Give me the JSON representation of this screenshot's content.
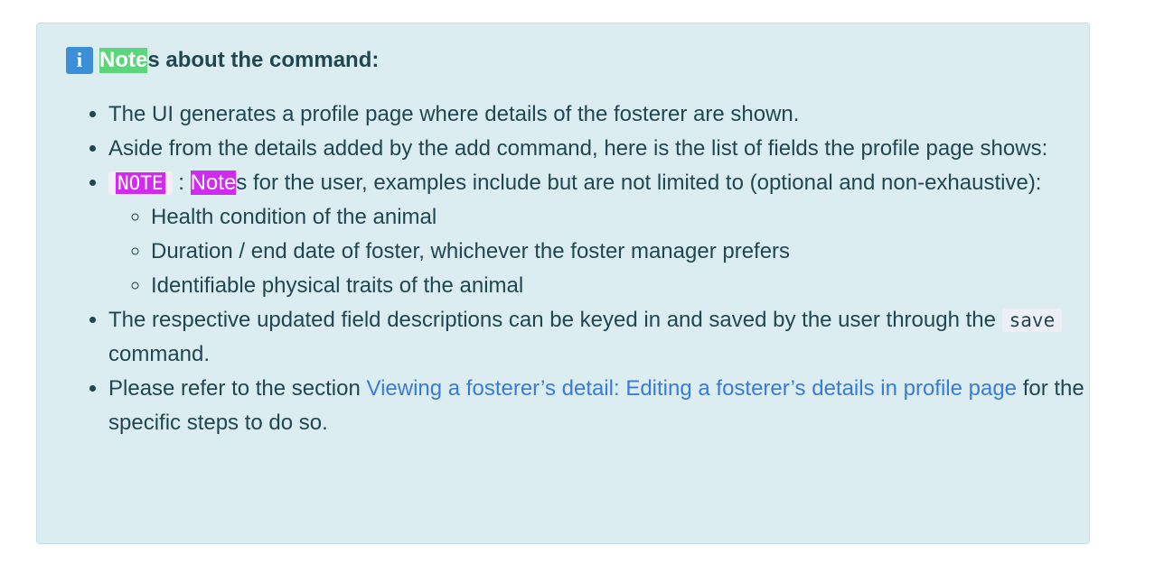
{
  "header": {
    "icon": "info-icon",
    "icon_glyph": "i",
    "title_highlight": "Note",
    "title_rest": "s about the command:"
  },
  "items": {
    "item1": "The UI generates a profile page where details of the fosterer are shown.",
    "item2": "Aside from the details added by the add command, here is the list of fields the profile page shows:",
    "item3": {
      "code": "NOTE",
      "separator": " : ",
      "highlight": "Note",
      "text": "s for the user, examples include but are not limited to (optional and non-exhaustive):",
      "subitems": [
        "Health condition of the animal",
        "Duration / end date of foster, whichever the foster manager prefers",
        "Identifiable physical traits of the animal"
      ]
    },
    "item4": {
      "before": "The respective updated field descriptions can be keyed in and saved by the user through the ",
      "code": "save",
      "after": " command."
    },
    "item5": {
      "before": "Please refer to the section ",
      "link": "Viewing a fosterer’s detail: Editing a fosterer’s details in profile page",
      "after": " for the specific steps to do so."
    }
  },
  "colors": {
    "box_background": "#dbedf1",
    "text": "#1f4752",
    "link": "#3a7bd5",
    "highlight_green": "#5dd57c",
    "highlight_magenta": "#d12bef",
    "icon_blue": "#3c8ed6"
  }
}
